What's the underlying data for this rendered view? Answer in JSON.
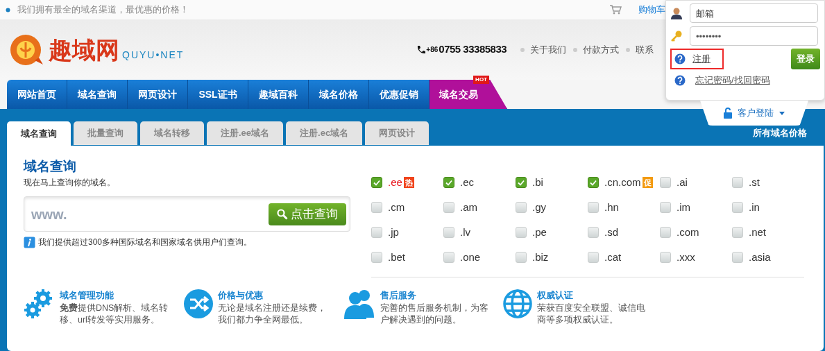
{
  "top_bar": {
    "slogan": "我们拥有最全的域名渠道，最优惠的价格！",
    "cart": "购物车"
  },
  "logo": {
    "name": "趣域网",
    "domain": "QUYU•NET"
  },
  "phone": {
    "prefix": "+86",
    "number": "0755 33385833"
  },
  "header_links": [
    "关于我们",
    "付款方式",
    "联系"
  ],
  "nav": [
    {
      "label": "网站首页",
      "kind": "normal"
    },
    {
      "label": "域名查询",
      "kind": "normal"
    },
    {
      "label": "网页设计",
      "kind": "normal"
    },
    {
      "label": "SSL证书",
      "kind": "normal"
    },
    {
      "label": "趣域百科",
      "kind": "normal"
    },
    {
      "label": "域名价格",
      "kind": "normal"
    },
    {
      "label": "优惠促销",
      "kind": "normal"
    },
    {
      "label": "域名交易",
      "kind": "hot",
      "badge": "HOT"
    }
  ],
  "login": {
    "email_placeholder": "邮箱",
    "password_value": "••••••••",
    "register": "注册",
    "register_highlighted": true,
    "login_button": "登录",
    "forgot": "忘记密码/找回密码",
    "tab_label": "客户登陆"
  },
  "sub_tabs": [
    {
      "label": "域名查询",
      "selected": true
    },
    {
      "label": "批量查询",
      "selected": false
    },
    {
      "label": "域名转移",
      "selected": false
    },
    {
      "label": "注册.ee域名",
      "selected": false
    },
    {
      "label": "注册.ec域名",
      "selected": false
    },
    {
      "label": "网页设计",
      "selected": false
    }
  ],
  "all_prices_link": "所有域名价格",
  "search": {
    "title": "域名查询",
    "subtitle": "现在马上查询你的域名。",
    "prefix": "www.",
    "button": "点击查询",
    "note": "我们提供超过300多种国际域名和国家域名供用户们查询。"
  },
  "domains": [
    {
      "label": ".ee",
      "checked": true,
      "emphasis": true,
      "badge": {
        "text": "热",
        "color": "#f0441c"
      }
    },
    {
      "label": ".ec",
      "checked": true,
      "emphasis": false
    },
    {
      "label": ".bi",
      "checked": true,
      "emphasis": false
    },
    {
      "label": ".cn.com",
      "checked": true,
      "emphasis": false,
      "badge": {
        "text": "促",
        "color": "#f39a10"
      }
    },
    {
      "label": ".ai",
      "checked": false,
      "emphasis": false
    },
    {
      "label": ".st",
      "checked": false,
      "emphasis": false
    },
    {
      "label": ".cm",
      "checked": false,
      "emphasis": false
    },
    {
      "label": ".am",
      "checked": false,
      "emphasis": false
    },
    {
      "label": ".gy",
      "checked": false,
      "emphasis": false
    },
    {
      "label": ".hn",
      "checked": false,
      "emphasis": false
    },
    {
      "label": ".im",
      "checked": false,
      "emphasis": false
    },
    {
      "label": ".in",
      "checked": false,
      "emphasis": false
    },
    {
      "label": ".jp",
      "checked": false,
      "emphasis": false
    },
    {
      "label": ".lv",
      "checked": false,
      "emphasis": false
    },
    {
      "label": ".pe",
      "checked": false,
      "emphasis": false
    },
    {
      "label": ".sd",
      "checked": false,
      "emphasis": false
    },
    {
      "label": ".com",
      "checked": false,
      "emphasis": false
    },
    {
      "label": ".net",
      "checked": false,
      "emphasis": false
    },
    {
      "label": ".bet",
      "checked": false,
      "emphasis": false
    },
    {
      "label": ".one",
      "checked": false,
      "emphasis": false
    },
    {
      "label": ".biz",
      "checked": false,
      "emphasis": false
    },
    {
      "label": ".cat",
      "checked": false,
      "emphasis": false
    },
    {
      "label": ".xxx",
      "checked": false,
      "emphasis": false
    },
    {
      "label": ".asia",
      "checked": false,
      "emphasis": false
    }
  ],
  "features": [
    {
      "kind": "gears",
      "title": "域名管理功能",
      "text": "**免费**提供DNS解析、域名转移、url转发等实用服务。"
    },
    {
      "kind": "shuffle",
      "title": "价格与优惠",
      "text": "无论是域名注册还是续费，我们都力争全网最低。"
    },
    {
      "kind": "people",
      "title": "售后服务",
      "text": "完善的售后服务机制，为客户解决遇到的问题。"
    },
    {
      "kind": "globe",
      "title": "权威认证",
      "text": "荣获百度安全联盟、诚信电商等多项权威认证。"
    }
  ]
}
